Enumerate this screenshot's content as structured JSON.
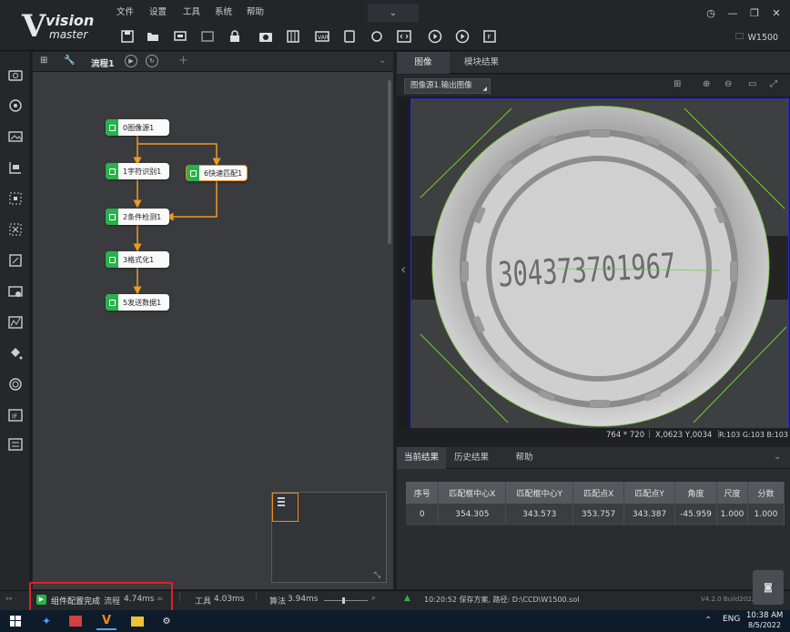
{
  "app": {
    "logo_v": "V",
    "logo_vision": "vision",
    "logo_master": "master",
    "solution_name": "W1500"
  },
  "menu": [
    "文件",
    "设置",
    "工具",
    "系统",
    "帮助"
  ],
  "toolbar_icons": [
    "save-icon",
    "open-folder-icon",
    "save-as-icon",
    "export-icon",
    "lock-icon",
    "camera-icon",
    "calibrate-icon",
    "var-icon",
    "device-icon",
    "refresh-icon",
    "code-icon",
    "run-once-icon",
    "run-loop-icon",
    "frame-icon"
  ],
  "sidebar_icons": [
    "camera-icon",
    "target-icon",
    "image-edit-icon",
    "measure-icon",
    "crop-icon",
    "locate-icon",
    "calc-icon",
    "image-tool-icon",
    "histogram-icon",
    "fill-icon",
    "ocr-icon",
    "if-icon",
    "settings-icon"
  ],
  "flow": {
    "tab_label": "流程1",
    "nodes": [
      "0图像源1",
      "1字符识别1",
      "6快速匹配1",
      "2条件检测1",
      "3格式化1",
      "5发送数据1"
    ]
  },
  "image_panel": {
    "tabs": [
      "图像",
      "模块结果"
    ],
    "source": "图像源1.输出图像",
    "ocr_text": "304373701967",
    "status": {
      "size": "764 * 720",
      "coords": "X,0623 Y,0034",
      "rgb": "R:103 G:103 B:103"
    }
  },
  "results": {
    "tabs": [
      "当前结果",
      "历史结果",
      "帮助"
    ],
    "columns": [
      "序号",
      "匹配框中心X",
      "匹配框中心Y",
      "匹配点X",
      "匹配点Y",
      "角度",
      "尺度",
      "分数"
    ],
    "rows": [
      [
        "0",
        "354.305",
        "343.573",
        "353.757",
        "343.387",
        "-45.959",
        "1.000",
        "1.000"
      ]
    ]
  },
  "status_bar": {
    "message": "组件配置完成",
    "flow_label": "流程",
    "flow_time": "4.74ms",
    "tool_label": "工具",
    "tool_time": "4.03ms",
    "algo_label": "算法",
    "algo_time": "3.94ms",
    "log": "10:20:52  保存方案, 路径: D:\\CCD\\W1500.sol",
    "version": "V4.2.0 Build2022"
  },
  "taskbar": {
    "lang": "ENG",
    "time": "10:38 AM",
    "date": "8/5/2022"
  },
  "colors": {
    "accent_green": "#27b24a",
    "accent_orange": "#ef8a1d",
    "highlight_red": "#e0202a"
  }
}
